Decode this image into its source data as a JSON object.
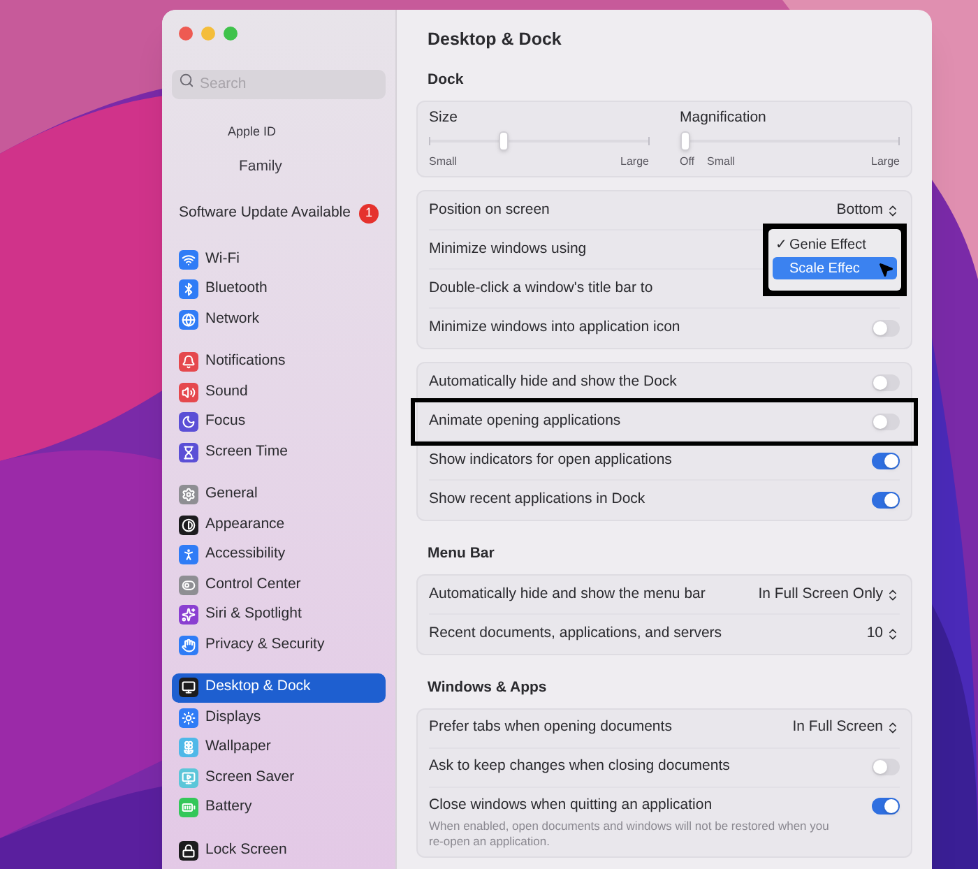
{
  "sidebar": {
    "search": {
      "placeholder": "Search"
    },
    "account": [
      {
        "label": "Apple ID"
      },
      {
        "label": "Family"
      }
    ],
    "update": {
      "label": "Software Update Available",
      "badge": "1"
    },
    "groups": [
      {
        "items": [
          {
            "label": "Wi-Fi",
            "color": "#2f7cf6",
            "selected": false
          },
          {
            "label": "Bluetooth",
            "color": "#2f7cf6",
            "selected": false
          },
          {
            "label": "Network",
            "color": "#2f7cf6",
            "selected": false
          }
        ]
      },
      {
        "items": [
          {
            "label": "Notifications",
            "color": "#e5484d",
            "selected": false
          },
          {
            "label": "Sound",
            "color": "#e5484d",
            "selected": false
          },
          {
            "label": "Focus",
            "color": "#5b4fd6",
            "selected": false
          },
          {
            "label": "Screen Time",
            "color": "#5b4fd6",
            "selected": false
          }
        ]
      },
      {
        "items": [
          {
            "label": "General",
            "color": "#8e8e93",
            "selected": false
          },
          {
            "label": "Appearance",
            "color": "#1c1c1e",
            "selected": false
          },
          {
            "label": "Accessibility",
            "color": "#2f7cf6",
            "selected": false
          },
          {
            "label": "Control Center",
            "color": "#8e8e93",
            "selected": false
          },
          {
            "label": "Siri & Spotlight",
            "color": "#8a3fd1",
            "selected": false
          },
          {
            "label": "Privacy & Security",
            "color": "#2f7cf6",
            "selected": false
          }
        ]
      },
      {
        "items": [
          {
            "label": "Desktop & Dock",
            "color": "#1c1c1e",
            "selected": true
          },
          {
            "label": "Displays",
            "color": "#2f7cf6",
            "selected": false
          },
          {
            "label": "Wallpaper",
            "color": "#4fb8e8",
            "selected": false
          },
          {
            "label": "Screen Saver",
            "color": "#5cc6d9",
            "selected": false
          },
          {
            "label": "Battery",
            "color": "#34c759",
            "selected": false
          }
        ]
      },
      {
        "items": [
          {
            "label": "Lock Screen",
            "color": "#1c1c1e",
            "selected": false
          }
        ]
      }
    ]
  },
  "main": {
    "title": "Desktop & Dock",
    "sections": [
      {
        "heading": "Dock",
        "sliders": [
          {
            "label": "Size",
            "level": 0.33,
            "marks": [
              "Small",
              "Large"
            ]
          },
          {
            "label": "Magnification",
            "level": 0,
            "marks": [
              "Off",
              "Small",
              "Large"
            ]
          }
        ],
        "cards": [
          [
            {
              "kind": "select",
              "label": "Position on screen",
              "value": "Bottom",
              "annotated": false
            },
            {
              "kind": "menu",
              "label": "Minimize windows using",
              "annotated": false
            },
            {
              "kind": "menu",
              "label": "Double-click a window's title bar to",
              "annotated": false
            },
            {
              "kind": "toggle",
              "label": "Minimize windows into application icon",
              "on": false,
              "annotated": false
            }
          ],
          [
            {
              "kind": "toggle",
              "label": "Automatically hide and show the Dock",
              "on": false,
              "annotated": false
            },
            {
              "kind": "toggle",
              "label": "Animate opening applications",
              "on": false,
              "annotated": true
            },
            {
              "kind": "toggle",
              "label": "Show indicators for open applications",
              "on": true,
              "annotated": false
            },
            {
              "kind": "toggle",
              "label": "Show recent applications in Dock",
              "on": true,
              "annotated": false
            }
          ]
        ]
      },
      {
        "heading": "Menu Bar",
        "cards": [
          [
            {
              "kind": "select",
              "label": "Automatically hide and show the menu bar",
              "value": "In Full Screen Only",
              "annotated": false
            },
            {
              "kind": "select",
              "label": "Recent documents, applications, and servers",
              "value": "10",
              "annotated": false
            }
          ]
        ]
      },
      {
        "heading": "Windows & Apps",
        "cards": [
          [
            {
              "kind": "select",
              "label": "Prefer tabs when opening documents",
              "value": "In Full Screen",
              "annotated": false
            },
            {
              "kind": "toggle",
              "label": "Ask to keep changes when closing documents",
              "on": false,
              "annotated": false
            },
            {
              "kind": "toggle",
              "label": "Close windows when quitting an application",
              "on": true,
              "note": "When enabled, open documents and windows will not be restored when you re-open an application.",
              "annotated": false
            }
          ]
        ]
      }
    ]
  },
  "dropdown": {
    "annotated": true,
    "check": "✓",
    "options": [
      {
        "label": "Genie Effect",
        "selected": true,
        "highlighted": false
      },
      {
        "label": "Scale Effec",
        "selected": false,
        "highlighted": true
      }
    ]
  }
}
